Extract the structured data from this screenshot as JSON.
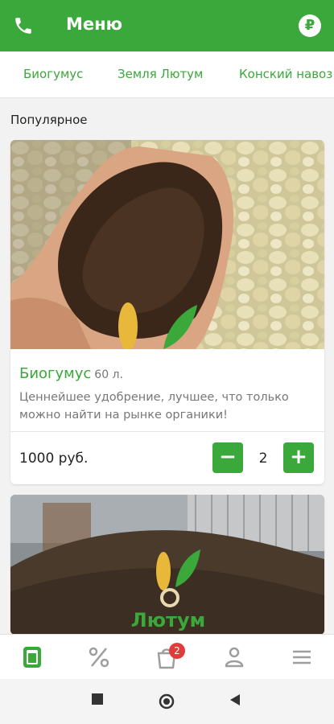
{
  "header": {
    "title": "Меню",
    "phone_icon": "phone-icon",
    "currency_icon": "ruble-icon",
    "currency_symbol": "₽"
  },
  "categories": [
    "Биогумус",
    "Земля Лютум",
    "Конский навоз"
  ],
  "section_title": "Популярное",
  "products": [
    {
      "name": "Биогумус",
      "volume": "60 л.",
      "description": "Ценнейшее удобрение, лучшее, что только можно найти на рынке органики!",
      "price": "1000 руб.",
      "quantity": "2",
      "minus": "−",
      "plus": "+"
    },
    {
      "logo_text": "Лютум"
    }
  ],
  "bottom_nav": {
    "items": [
      "menu-icon",
      "discount-icon",
      "cart-icon",
      "profile-icon",
      "more-icon"
    ],
    "cart_badge": "2"
  },
  "colors": {
    "accent": "#3aa83a",
    "badge": "#e23b3b"
  }
}
